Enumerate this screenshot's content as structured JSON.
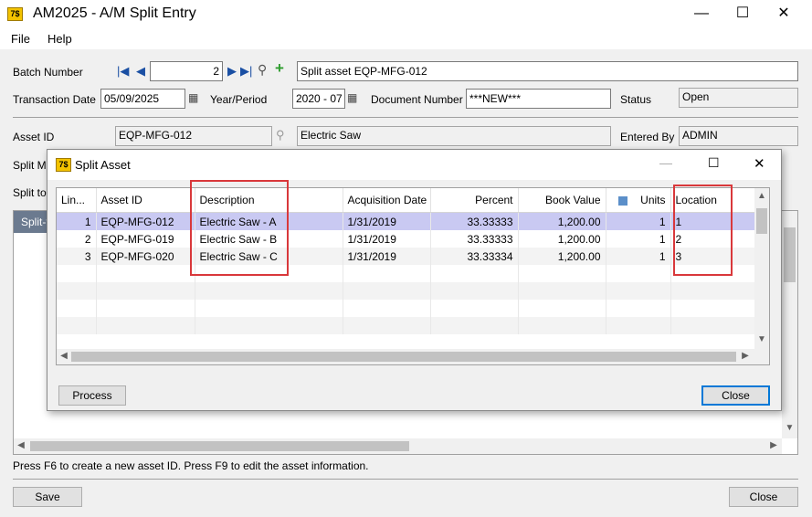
{
  "window": {
    "title": "AM2025 - A/M Split Entry",
    "icon_text": "7$"
  },
  "menu": [
    "File",
    "Help"
  ],
  "form": {
    "batch_label": "Batch Number",
    "batch_value": "2",
    "batch_comment": "Split asset EQP-MFG-012",
    "transaction_date_label": "Transaction Date",
    "transaction_date": "05/09/2025",
    "year_period_label": "Year/Period",
    "year_period": "2020 - 07",
    "document_number_label": "Document Number",
    "document_number": "***NEW***",
    "status_label": "Status",
    "status": "Open",
    "asset_id_label": "Asset ID",
    "asset_id": "EQP-MFG-012",
    "asset_desc": "Electric Saw",
    "entered_by_label": "Entered By",
    "entered_by": "ADMIN",
    "split_method_label": "Split Me",
    "split_to_label": "Split to",
    "grid_header_partial": "Split-to"
  },
  "hint": "Press F6 to create a new asset ID. Press F9 to edit the asset information.",
  "buttons": {
    "save": "Save",
    "close": "Close"
  },
  "dialog": {
    "title": "Split Asset",
    "columns": [
      "Lin...",
      "Asset ID",
      "Description",
      "Acquisition Date",
      "Percent",
      "Book Value",
      "Units",
      "Location"
    ],
    "rows": [
      [
        "1",
        "EQP-MFG-012",
        "Electric Saw - A",
        "1/31/2019",
        "33.33333",
        "1,200.00",
        "1",
        "1"
      ],
      [
        "2",
        "EQP-MFG-019",
        "Electric Saw - B",
        "1/31/2019",
        "33.33333",
        "1,200.00",
        "1",
        "2"
      ],
      [
        "3",
        "EQP-MFG-020",
        "Electric Saw - C",
        "1/31/2019",
        "33.33334",
        "1,200.00",
        "1",
        "3"
      ]
    ],
    "process": "Process",
    "close": "Close"
  },
  "colors": {
    "highlight_box": "#d9383b",
    "selected_row": "#c9c9f2",
    "focus_border": "#0078d7"
  }
}
